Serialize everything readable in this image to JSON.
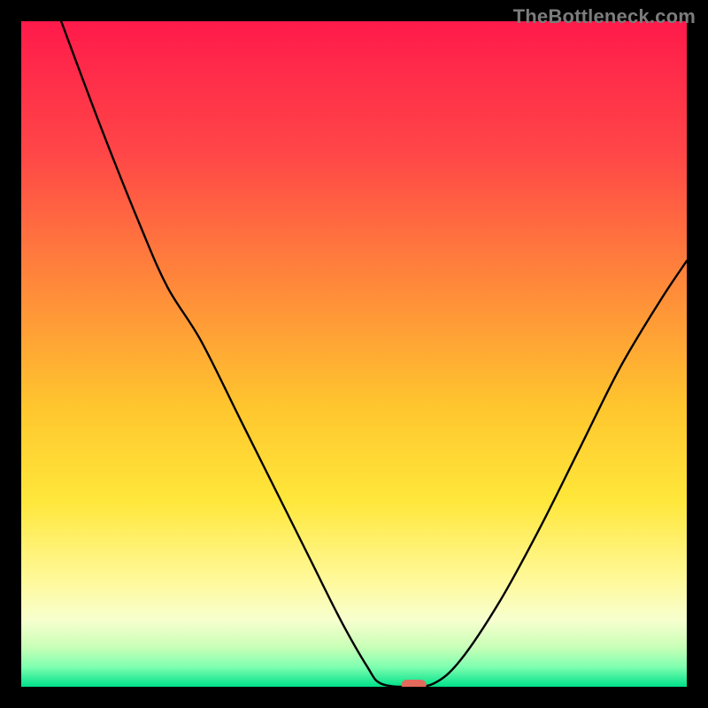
{
  "watermark": "TheBottleneck.com",
  "chart_data": {
    "type": "line",
    "title": "",
    "xlabel": "",
    "ylabel": "",
    "xlim": [
      0,
      100
    ],
    "ylim": [
      0,
      100
    ],
    "grid": false,
    "legend": false,
    "background_gradient": {
      "stops": [
        {
          "pos": 0.0,
          "color": "#ff1a4b"
        },
        {
          "pos": 0.2,
          "color": "#ff4747"
        },
        {
          "pos": 0.4,
          "color": "#ff8a3a"
        },
        {
          "pos": 0.58,
          "color": "#ffc62e"
        },
        {
          "pos": 0.72,
          "color": "#ffe73a"
        },
        {
          "pos": 0.84,
          "color": "#fff99a"
        },
        {
          "pos": 0.9,
          "color": "#f7ffcf"
        },
        {
          "pos": 0.94,
          "color": "#c9ffb7"
        },
        {
          "pos": 0.97,
          "color": "#7fffb0"
        },
        {
          "pos": 1.0,
          "color": "#00e08a"
        }
      ]
    },
    "curve": [
      {
        "x": 6,
        "y": 100
      },
      {
        "x": 12,
        "y": 84
      },
      {
        "x": 18,
        "y": 69
      },
      {
        "x": 22,
        "y": 60
      },
      {
        "x": 27,
        "y": 52
      },
      {
        "x": 33,
        "y": 40
      },
      {
        "x": 38,
        "y": 30
      },
      {
        "x": 43,
        "y": 20
      },
      {
        "x": 48,
        "y": 10
      },
      {
        "x": 52,
        "y": 3
      },
      {
        "x": 54,
        "y": 0.5
      },
      {
        "x": 58,
        "y": 0
      },
      {
        "x": 62,
        "y": 0.5
      },
      {
        "x": 66,
        "y": 4
      },
      {
        "x": 72,
        "y": 13
      },
      {
        "x": 78,
        "y": 24
      },
      {
        "x": 84,
        "y": 36
      },
      {
        "x": 90,
        "y": 48
      },
      {
        "x": 96,
        "y": 58
      },
      {
        "x": 100,
        "y": 64
      }
    ],
    "marker": {
      "x": 59,
      "y": 0,
      "color": "#e26a5c",
      "shape": "pill"
    }
  }
}
